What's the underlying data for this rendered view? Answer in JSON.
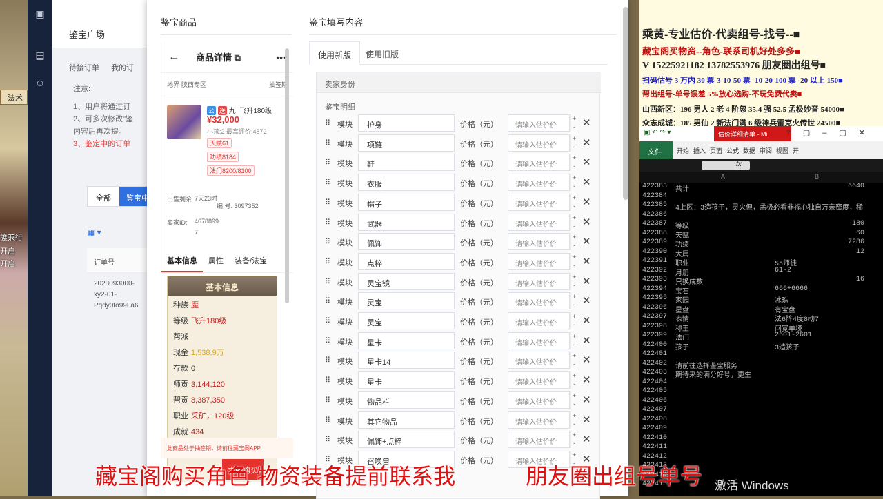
{
  "game": {
    "tab_label": "法术",
    "left_text_1": "護兼行",
    "left_text_2": "开启",
    "left_text_3": "开启"
  },
  "admin": {
    "header_title": "鉴宝广场",
    "tabs": [
      "待接订单",
      "我的订"
    ],
    "note_title": "注意:",
    "notes": [
      "1、用户将通过订",
      "2、可多次修改\"鉴",
      "内容后再次提。",
      "3、鉴定中的订单"
    ],
    "filter_all": "全部",
    "filter_active": "鉴宝中",
    "table_header": "订单号",
    "table_cell": [
      "2023093000-",
      "xy2-01-",
      "Pqdy0to99La6"
    ]
  },
  "modal": {
    "left_title": "鉴宝商品",
    "right_title": "鉴宝填写内容",
    "phone": {
      "title": "商品详情",
      "location": "地界-陕西专区",
      "status": "抽签期",
      "server": "九",
      "level": "飞升180级",
      "price": "¥32,000",
      "sub": "小孩:2 最高评价:4872",
      "chips": [
        "天赋61",
        "功绩8184",
        "法门8200/8100"
      ],
      "meta_row1_label": "出售剩余:",
      "meta_row1_value": "7天23时",
      "meta_id_label": "编 号:",
      "meta_id_value": "3097352",
      "meta_row2_label": "卖家ID:",
      "meta_row2_value": "4678899",
      "meta_row3_value": "7",
      "tabs": [
        "基本信息",
        "属性",
        "装备/法宝"
      ],
      "info_title": "基本信息",
      "info": [
        {
          "k": "种族",
          "v": "魔",
          "style": "v"
        },
        {
          "k": "等级",
          "v": "飞升180级",
          "style": "v"
        },
        {
          "k": "帮派",
          "v": "",
          "style": "v"
        },
        {
          "k": "现金",
          "v": "1,538,9万",
          "style": "y"
        },
        {
          "k": "存款",
          "v": "0",
          "style": "n"
        },
        {
          "k": "师贡",
          "v": "3,144,120",
          "style": "v"
        },
        {
          "k": "帮贡",
          "v": "8,387,350",
          "style": "v"
        },
        {
          "k": "职业",
          "v": "采矿，120级",
          "style": "v"
        },
        {
          "k": "成就",
          "v": "434",
          "style": "v"
        }
      ],
      "notice": "此商品处于抽签期，请前往藏宝阁APP",
      "buy": "立即购买"
    },
    "form": {
      "tab_new": "使用新版",
      "tab_old": "使用旧版",
      "seller": "卖家身份",
      "detail": "鉴宝明细",
      "module_label": "模块",
      "price_label": "价格（元）",
      "price_placeholder": "请输入估价价",
      "modules": [
        "护身",
        "项链",
        "鞋",
        "衣服",
        "帽子",
        "武器",
        "佩饰",
        "点粹",
        "灵宝镜",
        "灵宝",
        "灵宝",
        "星卡",
        "星卡14",
        "星卡",
        "物品栏",
        "其它物品",
        "佩饰+点粹",
        "召唤兽"
      ]
    }
  },
  "notes": {
    "line1": "乘黄-专业估价-代卖组号-找号--■",
    "line2": "藏宝阁买物资--角色-联系司机好处多多■",
    "line3": "V 15225921182   13782553976 朋友圈出组号■",
    "line4": "扫码估号 3 万内 30 票-3-10-50 票  -10-20-100 票- 20 以上 150■",
    "line5": "帮出组号-单号误差 5%放心选购-不玩免费代卖■",
    "line6": "山西新区：196 男人 2 老 4 阶忽 35.4 强 52.5 孟极妙音 54000■",
    "line7": "众志成城：185 男仙 2 新法门满 6 级神兵雷克火传世 24500■"
  },
  "excel": {
    "title": "估价详细清单 - Mi...",
    "file_tab": "文件",
    "ribbon": [
      "开始",
      "插入",
      "页面",
      "公式",
      "数据",
      "审阅",
      "视图",
      "开"
    ],
    "col_a": "A",
    "col_b": "B",
    "rows": [
      {
        "n": "422383",
        "a": "共计",
        "b": "",
        "c": "6640"
      },
      {
        "n": "422384",
        "a": "",
        "b": "",
        "c": ""
      },
      {
        "n": "422385",
        "a": "4上区：3造孩子，灵火但，孟极必看非福心独自万亲密度，稀",
        "b": "",
        "c": ""
      },
      {
        "n": "422386",
        "a": "",
        "b": "",
        "c": ""
      },
      {
        "n": "422387",
        "a": "等级",
        "b": "",
        "c": "180"
      },
      {
        "n": "422388",
        "a": "天赋",
        "b": "",
        "c": "60"
      },
      {
        "n": "422389",
        "a": "功绩",
        "b": "",
        "c": "7286"
      },
      {
        "n": "422390",
        "a": "大属",
        "b": "",
        "c": "12"
      },
      {
        "n": "422391",
        "a": "职业",
        "b": "55师徒",
        "c": ""
      },
      {
        "n": "422392",
        "a": "月册",
        "b": "61-2",
        "c": ""
      },
      {
        "n": "422393",
        "a": "只换成数",
        "b": "",
        "c": "16"
      },
      {
        "n": "422394",
        "a": "宝石",
        "b": "666+6666",
        "c": ""
      },
      {
        "n": "422395",
        "a": "家园",
        "b": "冰珠",
        "c": ""
      },
      {
        "n": "422396",
        "a": "星盘",
        "b": "有宝盘",
        "c": ""
      },
      {
        "n": "422397",
        "a": "表情",
        "b": "法6阵4度8动7",
        "c": ""
      },
      {
        "n": "422398",
        "a": "称王",
        "b": "问宽单境",
        "c": ""
      },
      {
        "n": "422399",
        "a": "法门",
        "b": "2601-2601",
        "c": ""
      },
      {
        "n": "422400",
        "a": "孩子",
        "b": "3造孩子",
        "c": ""
      },
      {
        "n": "422401",
        "a": "",
        "b": "",
        "c": ""
      },
      {
        "n": "422402",
        "a": "请前往选择鉴宝服务",
        "b": "",
        "c": ""
      },
      {
        "n": "422403",
        "a": "期待来的满分好号，更生",
        "b": "",
        "c": ""
      },
      {
        "n": "422404",
        "a": "",
        "b": "",
        "c": ""
      },
      {
        "n": "422405",
        "a": "",
        "b": "",
        "c": ""
      },
      {
        "n": "422406",
        "a": "",
        "b": "",
        "c": ""
      },
      {
        "n": "422407",
        "a": "",
        "b": "",
        "c": ""
      },
      {
        "n": "422408",
        "a": "",
        "b": "",
        "c": ""
      },
      {
        "n": "422409",
        "a": "",
        "b": "",
        "c": ""
      },
      {
        "n": "422410",
        "a": "",
        "b": "",
        "c": ""
      },
      {
        "n": "422411",
        "a": "",
        "b": "",
        "c": ""
      },
      {
        "n": "422412",
        "a": "",
        "b": "",
        "c": ""
      },
      {
        "n": "422413",
        "a": "",
        "b": "",
        "c": ""
      },
      {
        "n": "422414",
        "a": "",
        "b": "",
        "c": ""
      },
      {
        "n": "422415",
        "a": "",
        "b": "",
        "c": ""
      }
    ],
    "activate": "激活 Windows"
  },
  "overlay": {
    "left": "藏宝阁购买角色 物资装备提前联系我",
    "right": "朋友圈出组号单号"
  }
}
